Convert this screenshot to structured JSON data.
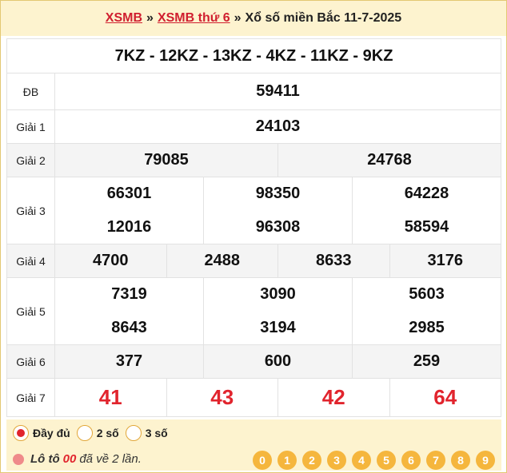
{
  "breadcrumb": {
    "link1": "XSMB",
    "sep1": "»",
    "link2": "XSMB thứ 6",
    "sep2": "»",
    "current": "Xổ số miền Bắc 11-7-2025"
  },
  "codes": "7KZ - 12KZ - 13KZ - 4KZ - 11KZ - 9KZ",
  "prizes": {
    "db": {
      "label": "ĐB",
      "numbers": [
        "59411"
      ]
    },
    "g1": {
      "label": "Giải 1",
      "numbers": [
        "24103"
      ]
    },
    "g2": {
      "label": "Giải 2",
      "numbers": [
        "79085",
        "24768"
      ]
    },
    "g3": {
      "label": "Giải 3",
      "numbers": [
        "66301",
        "98350",
        "64228",
        "12016",
        "96308",
        "58594"
      ]
    },
    "g4": {
      "label": "Giải 4",
      "numbers": [
        "4700",
        "2488",
        "8633",
        "3176"
      ]
    },
    "g5": {
      "label": "Giải 5",
      "numbers": [
        "7319",
        "3090",
        "5603",
        "8643",
        "3194",
        "2985"
      ]
    },
    "g6": {
      "label": "Giải 6",
      "numbers": [
        "377",
        "600",
        "259"
      ]
    },
    "g7": {
      "label": "Giải 7",
      "numbers": [
        "41",
        "43",
        "42",
        "64"
      ]
    }
  },
  "options": {
    "full": "Đầy đủ",
    "two": "2 số",
    "three": "3 số",
    "selected": "full"
  },
  "loto": {
    "prefix": "Lô tô",
    "number": "00",
    "suffix": "đã về 2 lần."
  },
  "digits": [
    "0",
    "1",
    "2",
    "3",
    "4",
    "5",
    "6",
    "7",
    "8",
    "9"
  ],
  "colors": {
    "accent_red": "#e1242d",
    "header_bg": "#fdf3cf",
    "codes_blue": "#1660b5",
    "digit_orange": "#f5b63d"
  }
}
